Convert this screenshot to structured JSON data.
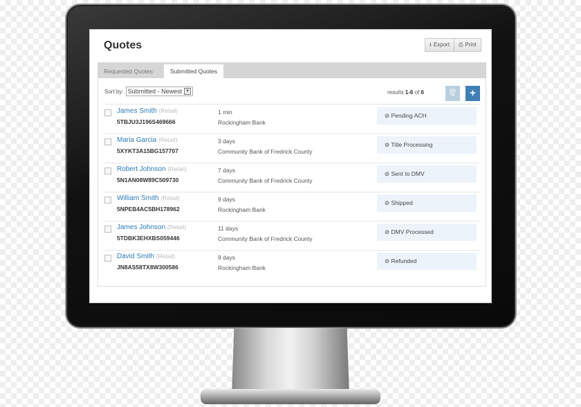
{
  "page": {
    "title": "Quotes",
    "export_label": "Export",
    "print_label": "Print"
  },
  "tabs": [
    {
      "label": "Requested Quotes",
      "active": false
    },
    {
      "label": "Submitted Quotes",
      "active": true
    }
  ],
  "toolbar": {
    "sort_label": "Sort by:",
    "sort_value": "Submitted - Newest",
    "results_prefix": "results",
    "results_range": "1-6",
    "results_of": "of",
    "results_total": "6"
  },
  "colors": {
    "link": "#2d7ab8",
    "primary": "#3f7fb6",
    "status_bg": "#edf3fb"
  },
  "rows": [
    {
      "name": "James Smith",
      "type": "(Retail)",
      "vin": "5TBJU3J196S469666",
      "time": "1 min",
      "bank": "Rockingham Bank",
      "status": "Pending ACH"
    },
    {
      "name": "Maria Garcia",
      "type": "(Retail)",
      "vin": "5XYKT3A15BG157707",
      "time": "3 days",
      "bank": "Community Bank of Fredrick County",
      "status": "Title Processing"
    },
    {
      "name": "Robert Johnson",
      "type": "(Retail)",
      "vin": "5N1AN08W89C509730",
      "time": "7 days",
      "bank": "Community Bank of Fredrick County",
      "status": "Sent to DMV"
    },
    {
      "name": "William Smith",
      "type": "(Retail)",
      "vin": "5NPEB4AC5BH178962",
      "time": "9 days",
      "bank": "Rockingham Bank",
      "status": "Shipped"
    },
    {
      "name": "James Johnson",
      "type": "(Retail)",
      "vin": "5TDBK3EHXBS059446",
      "time": "11 days",
      "bank": "Community Bank of Fredrick County",
      "status": "DMV Processed"
    },
    {
      "name": "David Smith",
      "type": "(Retail)",
      "vin": "JN8AS58TX8W300586",
      "time": "9 days",
      "bank": "Rockingham Bank",
      "status": "Refunded"
    }
  ]
}
